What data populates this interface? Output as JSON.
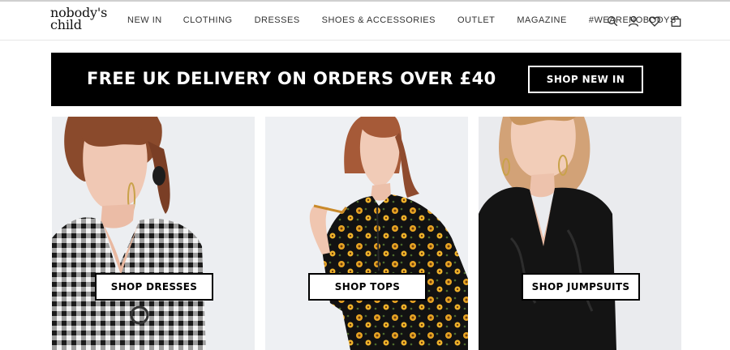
{
  "brand": {
    "logo_line1": "nobody's",
    "logo_line2": "child"
  },
  "nav": {
    "items": [
      {
        "label": "NEW IN"
      },
      {
        "label": "CLOTHING"
      },
      {
        "label": "DRESSES"
      },
      {
        "label": "SHOES & ACCESSORIES"
      },
      {
        "label": "OUTLET"
      },
      {
        "label": "MAGAZINE"
      },
      {
        "label": "#WEARENOBODYS"
      }
    ]
  },
  "header_icons": [
    "search-icon",
    "account-icon",
    "wishlist-heart-icon",
    "shopping-bag-icon"
  ],
  "banner": {
    "text": "FREE UK DELIVERY ON ORDERS OVER £40",
    "button_label": "SHOP NEW IN"
  },
  "tiles": [
    {
      "button_label": "SHOP DRESSES"
    },
    {
      "button_label": "SHOP TOPS"
    },
    {
      "button_label": "SHOP JUMPSUITS"
    }
  ],
  "colors": {
    "banner_bg": "#000000",
    "text": "#222222",
    "tile_bg": "#eef0f2"
  }
}
